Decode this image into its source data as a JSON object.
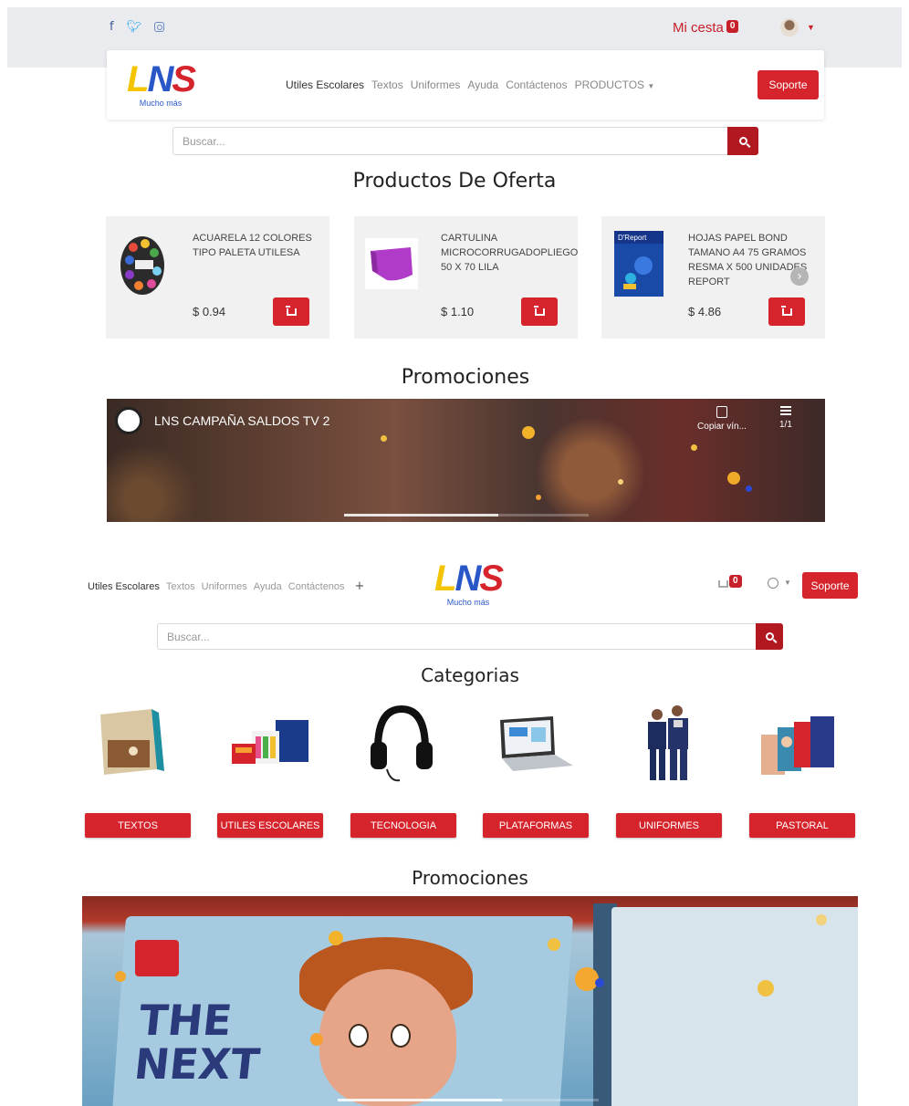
{
  "brand": {
    "logo_text": "LNS",
    "tagline": "Mucho más"
  },
  "screen1": {
    "topbar": {
      "social": [
        "facebook-icon",
        "twitter-icon",
        "instagram-icon"
      ],
      "cart_label": "Mi cesta",
      "cart_count": "0"
    },
    "nav": {
      "links": [
        "Utiles Escolares",
        "Textos",
        "Uniformes",
        "Ayuda",
        "Contáctenos",
        "PRODUCTOS"
      ],
      "support_label": "Soporte"
    },
    "search": {
      "placeholder": "Buscar..."
    },
    "offers_title": "Productos De Oferta",
    "offers": [
      {
        "name": "ACUARELA 12 COLORES TIPO PALETA UTILESA",
        "price": "$ 0.94"
      },
      {
        "name": "CARTULINA MICROCORRUGADOPLIEGO 50 X 70 LILA",
        "price": "$ 1.10"
      },
      {
        "name": "HOJAS PAPEL BOND TAMANO A4 75 GRAMOS RESMA X 500 UNIDADES REPORT",
        "price": "$ 4.86"
      }
    ],
    "promos_title": "Promociones",
    "video": {
      "title": "LNS CAMPAÑA SALDOS TV 2",
      "copy_label": "Copiar vín...",
      "playlist_count": "1/1",
      "progress": 0.63
    }
  },
  "screen2": {
    "nav": {
      "links": [
        "Utiles Escolares",
        "Textos",
        "Uniformes",
        "Ayuda",
        "Contáctenos"
      ],
      "more_icon": "+",
      "cart_count": "0",
      "support_label": "Soporte"
    },
    "search": {
      "placeholder": "Buscar..."
    },
    "categories_title": "Categorias",
    "categories": [
      "TEXTOS",
      "UTILES ESCOLARES",
      "TECNOLOGIA",
      "PLATAFORMAS",
      "UNIFORMES",
      "PASTORAL"
    ],
    "promos_title": "Promociones",
    "video_cover_text": "THE\nNEXT"
  },
  "colors": {
    "accent": "#d6242c",
    "search_button": "#b1181f",
    "topbar": "#e9ebee"
  }
}
